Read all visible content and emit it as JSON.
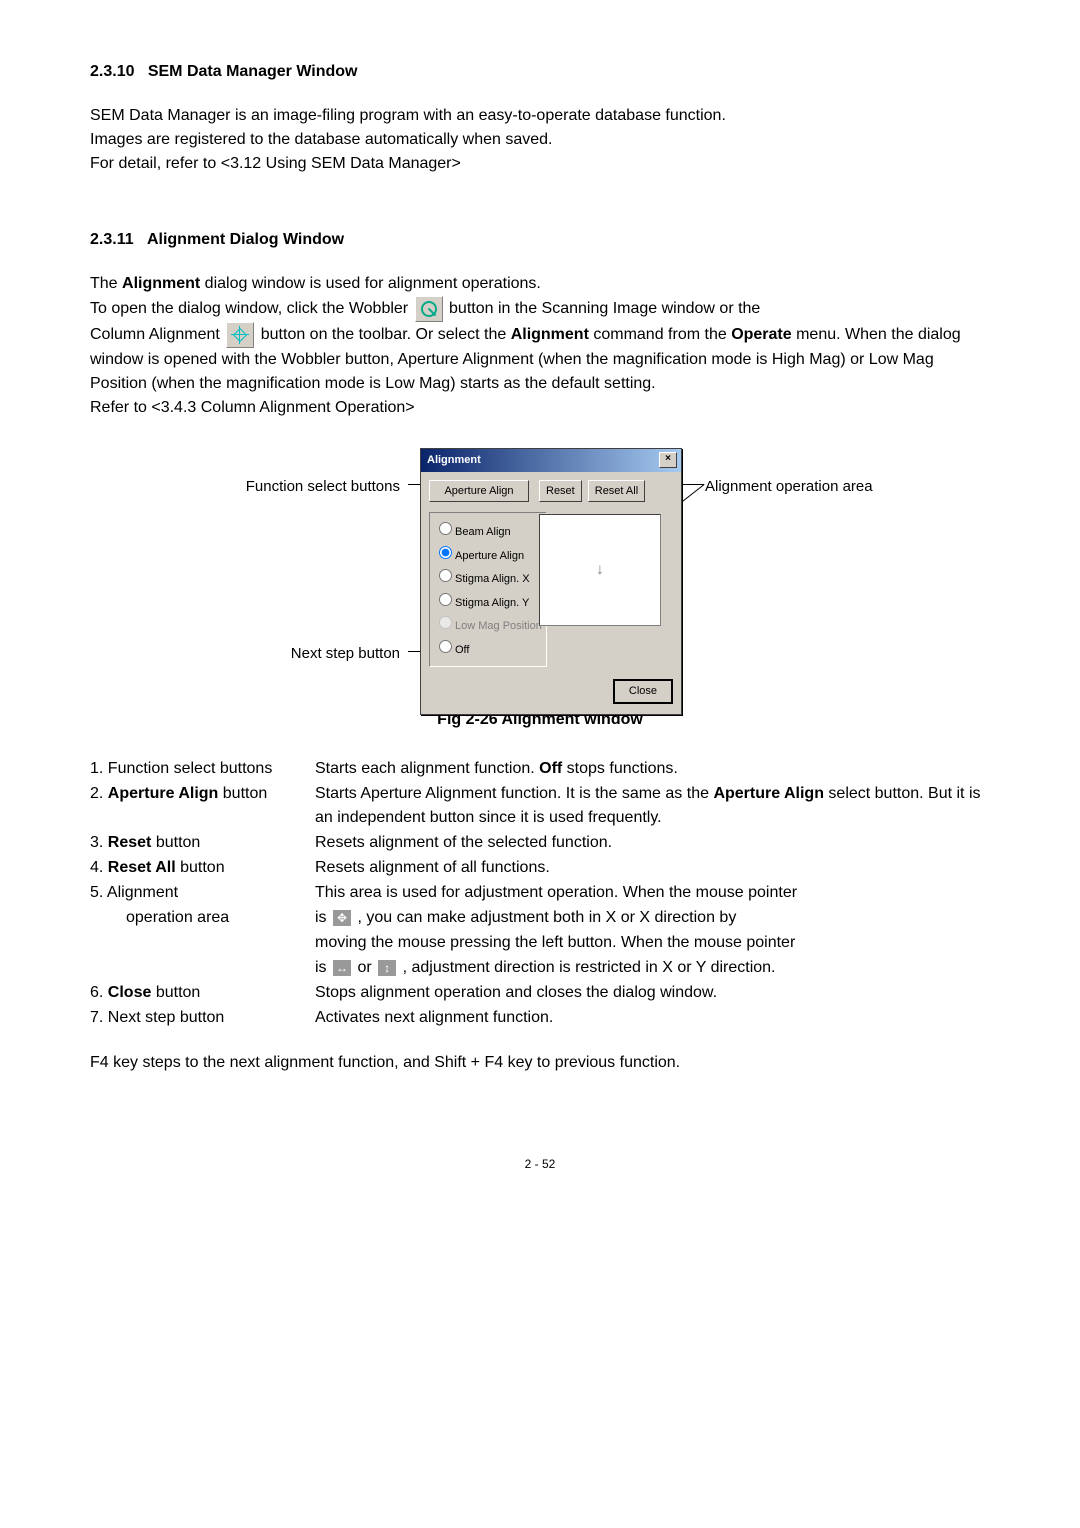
{
  "section1": {
    "number": "2.3.10",
    "title": "SEM Data Manager Window",
    "p1": "SEM Data Manager is an image-filing program with an easy-to-operate database function.",
    "p2": "Images are registered to the database automatically when saved.",
    "p3": "For detail, refer to <3.12 Using SEM Data Manager>"
  },
  "section2": {
    "number": "2.3.11",
    "title": "Alignment Dialog Window",
    "intro_a": "The ",
    "intro_b": "Alignment",
    "intro_c": " dialog window is used for alignment operations.",
    "p2a": "To open the dialog window, click the Wobbler ",
    "p2b": " button in the Scanning Image window or the",
    "p3a": "Column Alignment ",
    "p3b": " button on the toolbar. Or select the ",
    "p3bold": "Alignment",
    "p3c": " command from the ",
    "p4a": "Operate",
    "p4b": " menu. When the dialog window is opened with the Wobbler button, Aperture Alignment (when the magnification mode is High Mag) or Low Mag Position (when the magnification mode is Low Mag) starts as the default setting.",
    "p5": "Refer to <3.4.3 Column Alignment Operation>"
  },
  "dialog": {
    "title": "Alignment",
    "aperture_align": "Aperture Align",
    "reset": "Reset",
    "reset_all": "Reset All",
    "radios": {
      "beam": "Beam Align",
      "aperture": "Aperture Align",
      "stigx": "Stigma Align. X",
      "stigy": "Stigma Align. Y",
      "lowmag": "Low Mag Position",
      "off": "Off"
    },
    "arrow": "↓",
    "close": "Close"
  },
  "annotations": {
    "func_buttons": "Function select buttons",
    "next_step": "Next step button",
    "align_op_area": "Alignment operation area"
  },
  "fig_caption": "Fig 2-26 Alignment window",
  "items": {
    "i1_label": "1. Function select buttons",
    "i1_desc_a": "Starts each alignment function. ",
    "i1_desc_b": "Off",
    "i1_desc_c": " stops functions.",
    "i2_label_a": "2. ",
    "i2_label_b": "Aperture Align",
    "i2_label_c": " button",
    "i2_desc_a": "Starts Aperture Alignment function. It is the same as the ",
    "i2_desc_b": "Aperture Align",
    "i2_desc_c": " select button. But it is an independent button since it is used frequently.",
    "i3_label_a": "3. ",
    "i3_label_b": "Reset",
    "i3_label_c": " button",
    "i3_desc": "Resets alignment of the selected function.",
    "i4_label_a": "4. ",
    "i4_label_b": "Reset All",
    "i4_label_c": " button",
    "i4_desc": "Resets alignment of all functions.",
    "i5_label1": "5. Alignment",
    "i5_label2": "operation area",
    "i5_desc_a": "This area is used for adjustment operation. When the mouse pointer",
    "i5_desc_b1": "is ",
    "i5_desc_b2": " , you can make adjustment both in X or X direction by",
    "i5_desc_c": "moving the mouse pressing the left button. When the mouse pointer",
    "i5_desc_d1": "is ",
    "i5_desc_d2": " or ",
    "i5_desc_d3": " , adjustment direction is restricted in X or Y direction.",
    "i6_label_a": "6. ",
    "i6_label_b": "Close",
    "i6_label_c": " button",
    "i6_desc": "Stops alignment operation and closes the dialog window.",
    "i7_label": "7. Next step button",
    "i7_desc": "Activates next alignment function."
  },
  "footnote": "F4 key steps to the next alignment function, and Shift + F4 key to previous function.",
  "cursor_move": "✥",
  "cursor_h": "↔",
  "cursor_v": "↕",
  "page_num": "2 - 52"
}
